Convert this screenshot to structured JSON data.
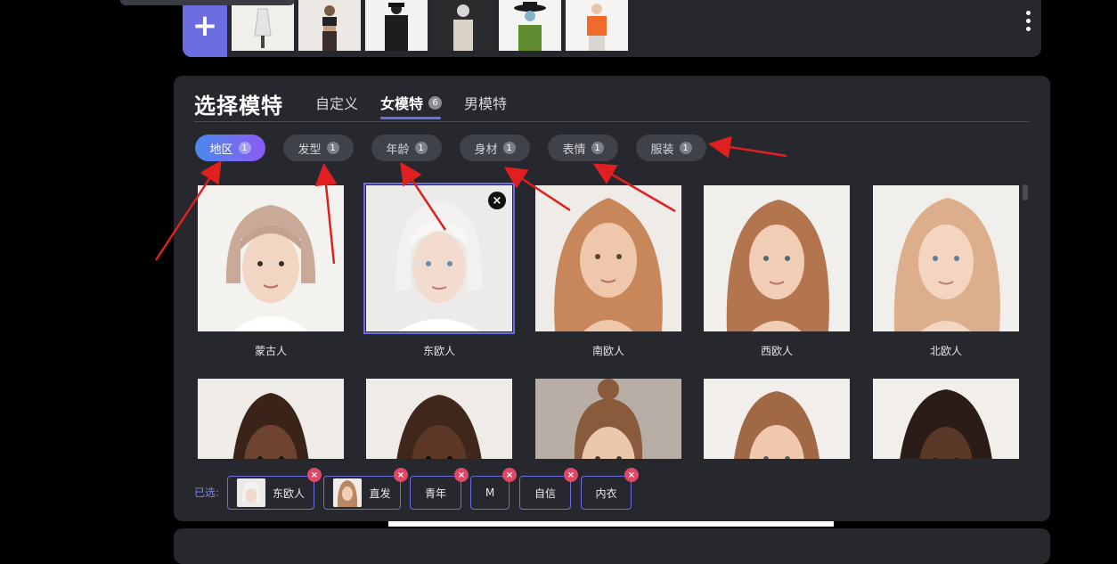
{
  "top_strip": {
    "add_label": "+",
    "thumbnails": [
      "hanger-dress",
      "crop-top-model",
      "suited-mannequin",
      "coat-mannequin",
      "hat-mannequin",
      "orange-sweater-model"
    ]
  },
  "panel": {
    "title": "选择模特",
    "tabs": [
      {
        "label": "自定义",
        "badge": ""
      },
      {
        "label": "女模特",
        "badge": "6"
      },
      {
        "label": "男模特",
        "badge": ""
      }
    ],
    "filters": [
      {
        "label": "地区",
        "badge": "1"
      },
      {
        "label": "发型",
        "badge": "1"
      },
      {
        "label": "年龄",
        "badge": "1"
      },
      {
        "label": "身材",
        "badge": "1"
      },
      {
        "label": "表情",
        "badge": "1"
      },
      {
        "label": "服装",
        "badge": "1"
      }
    ],
    "models_row1": [
      {
        "label": "蒙古人"
      },
      {
        "label": "东欧人"
      },
      {
        "label": "南欧人"
      },
      {
        "label": "西欧人"
      },
      {
        "label": "北欧人"
      }
    ],
    "models_row2_count": 5,
    "close_icon": "×"
  },
  "selected": {
    "label": "已选:",
    "chips": [
      {
        "label": "东欧人"
      },
      {
        "label": "直发"
      },
      {
        "label": "青年"
      },
      {
        "label": "M"
      },
      {
        "label": "自信"
      },
      {
        "label": "内衣"
      }
    ],
    "remove_icon": "×"
  },
  "colors": {
    "accent": "#6c6de0",
    "panel_bg": "#26282e",
    "arrow": "#e02020",
    "remove": "#e04868"
  }
}
